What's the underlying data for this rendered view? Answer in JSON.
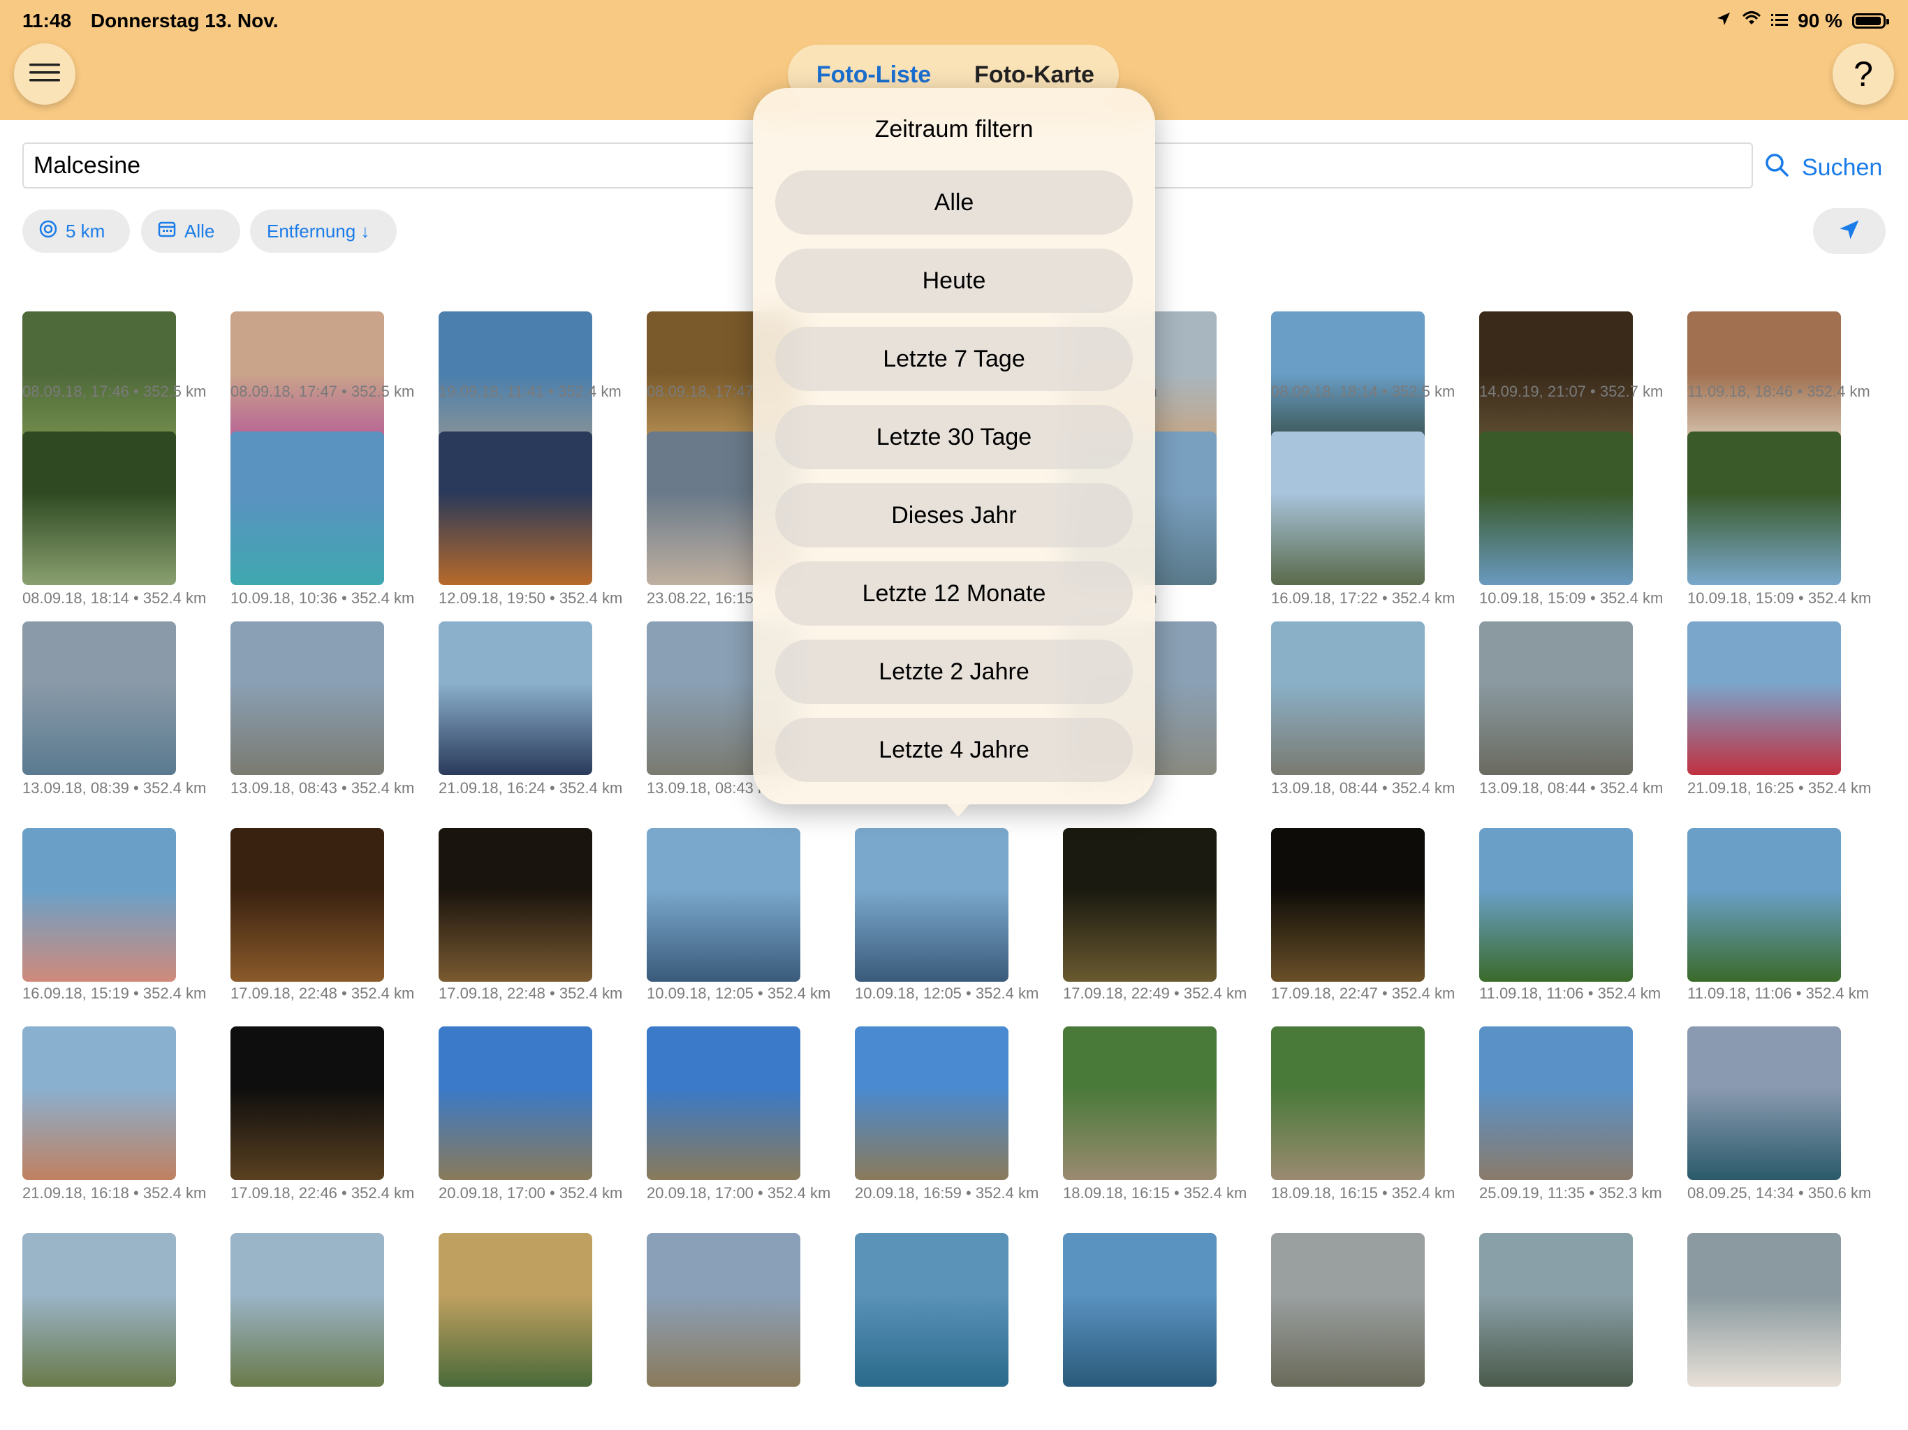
{
  "status_bar": {
    "time": "11:48",
    "date": "Donnerstag 13. Nov.",
    "battery": "90 %",
    "icons": [
      "location-arrow-icon",
      "wifi-icon",
      "list-icon",
      "battery-icon"
    ]
  },
  "header": {
    "menu_icon": "hamburger-icon",
    "help_label": "?",
    "tabs": [
      {
        "label": "Foto-Liste",
        "selected": true
      },
      {
        "label": "Foto-Karte",
        "selected": false
      }
    ]
  },
  "search": {
    "value": "Malcesine",
    "button_label": "Suchen",
    "icon": "search-icon"
  },
  "filters": {
    "distance": {
      "label": "5 km",
      "icon": "radius-icon"
    },
    "time": {
      "label": "Alle",
      "icon": "calendar-icon"
    },
    "sort": {
      "label": "Entfernung ↓"
    },
    "locate_icon": "location-arrow-icon"
  },
  "popover": {
    "title": "Zeitraum filtern",
    "options": [
      "Alle",
      "Heute",
      "Letzte 7 Tage",
      "Letzte 30 Tage",
      "Dieses Jahr",
      "Letzte 12 Monate",
      "Letzte 2 Jahre",
      "Letzte 4 Jahre"
    ]
  },
  "photos": [
    {
      "caption": "08.09.18, 17:46 • 352.5 km",
      "colors": [
        "#4f6a3a",
        "#7f9a52"
      ]
    },
    {
      "caption": "08.09.18, 17:47 • 352.5 km",
      "colors": [
        "#c9a48a",
        "#b04a9a"
      ]
    },
    {
      "caption": "19.09.18, 11:41 • 352.4 km",
      "colors": [
        "#4a7fae",
        "#9e9a8e"
      ]
    },
    {
      "caption": "08.09.18, 17:47",
      "colors": [
        "#7a5a2a",
        "#c8a060"
      ]
    },
    {
      "caption": "",
      "colors": [
        "#ffffff",
        "#ffffff"
      ]
    },
    {
      "caption": "33 • 352.5 km",
      "colors": [
        "#a8b6c0",
        "#d0a070"
      ]
    },
    {
      "caption": "08.09.18, 18:14 • 352.5 km",
      "colors": [
        "#6a9ec6",
        "#2a3a2a"
      ]
    },
    {
      "caption": "14.09.19, 21:07 • 352.7 km",
      "colors": [
        "#3a2a1a",
        "#6a5a3a"
      ]
    },
    {
      "caption": "11.09.18, 18:46 • 352.4 km",
      "colors": [
        "#a07050",
        "#e8e0d0"
      ]
    },
    {
      "caption": "08.09.18, 18:14 • 352.4 km",
      "colors": [
        "#2f4a22",
        "#8aa070"
      ]
    },
    {
      "caption": "10.09.18, 10:36 • 352.4 km",
      "colors": [
        "#5a92c0",
        "#3fa8b0"
      ]
    },
    {
      "caption": "12.09.18, 19:50 • 352.4 km",
      "colors": [
        "#2a3a5a",
        "#b86a2a"
      ]
    },
    {
      "caption": "23.08.22, 16:15",
      "colors": [
        "#6a7a8a",
        "#c0b0a0"
      ]
    },
    {
      "caption": "",
      "colors": [
        "#ffffff",
        "#ffffff"
      ]
    },
    {
      "caption": "22 • 352.4 km",
      "colors": [
        "#7aa0c0",
        "#5a7a8a"
      ]
    },
    {
      "caption": "16.09.18, 17:22 • 352.4 km",
      "colors": [
        "#a8c4dc",
        "#5a6a4a"
      ]
    },
    {
      "caption": "10.09.18, 15:09 • 352.4 km",
      "colors": [
        "#3a5a2a",
        "#6a9ac0"
      ]
    },
    {
      "caption": "10.09.18, 15:09 • 352.4 km",
      "colors": [
        "#3a5a2a",
        "#7aa8cc"
      ]
    },
    {
      "caption": "13.09.18, 08:39 • 352.4 km",
      "colors": [
        "#8a9aa8",
        "#5a7a90"
      ]
    },
    {
      "caption": "13.09.18, 08:43 • 352.4 km",
      "colors": [
        "#8aa0b4",
        "#7a7a70"
      ]
    },
    {
      "caption": "21.09.18, 16:24 • 352.4 km",
      "colors": [
        "#8ab0cc",
        "#2a3a5a"
      ]
    },
    {
      "caption": "13.09.18, 08:43 km",
      "colors": [
        "#8aa0b4",
        "#7a7a70"
      ]
    },
    {
      "caption": "",
      "colors": [
        "#ffffff",
        "#ffffff"
      ]
    },
    {
      "caption": "8:44 • 352.4",
      "colors": [
        "#8aa0b4",
        "#8a8a80"
      ]
    },
    {
      "caption": "13.09.18, 08:44 • 352.4 km",
      "colors": [
        "#8ab0c8",
        "#7a7a70"
      ]
    },
    {
      "caption": "13.09.18, 08:44 • 352.4 km",
      "colors": [
        "#8a9aa0",
        "#6a6a60"
      ]
    },
    {
      "caption": "21.09.18, 16:25 • 352.4 km",
      "colors": [
        "#7aa6cc",
        "#c03040"
      ]
    },
    {
      "caption": "16.09.18, 15:19 • 352.4 km",
      "colors": [
        "#6aa0c8",
        "#d08a7a"
      ]
    },
    {
      "caption": "17.09.18, 22:48 • 352.4 km",
      "colors": [
        "#3a2210",
        "#8a5a2a"
      ]
    },
    {
      "caption": "17.09.18, 22:48 • 352.4 km",
      "colors": [
        "#1a140e",
        "#7a5a30"
      ]
    },
    {
      "caption": "10.09.18, 12:05 • 352.4 km",
      "colors": [
        "#7aa8cc",
        "#3a5a7a"
      ]
    },
    {
      "caption": "10.09.18, 12:05 • 352.4 km",
      "colors": [
        "#7aa8cc",
        "#3a5a7a"
      ]
    },
    {
      "caption": "17.09.18, 22:49 • 352.4 km",
      "colors": [
        "#1a1a10",
        "#6a5a30"
      ]
    },
    {
      "caption": "17.09.18, 22:47 • 352.4 km",
      "colors": [
        "#0e0c08",
        "#6a5028"
      ]
    },
    {
      "caption": "11.09.18, 11:06 • 352.4 km",
      "colors": [
        "#6aa0c8",
        "#3a6a2a"
      ]
    },
    {
      "caption": "11.09.18, 11:06 • 352.4 km",
      "colors": [
        "#6aa0c8",
        "#3a6a2a"
      ]
    },
    {
      "caption": "21.09.18, 16:18 • 352.4 km",
      "colors": [
        "#8ab0d0",
        "#c08060"
      ]
    },
    {
      "caption": "17.09.18, 22:46 • 352.4 km",
      "colors": [
        "#0e0e0e",
        "#5a4020"
      ]
    },
    {
      "caption": "20.09.18, 17:00 • 352.4 km",
      "colors": [
        "#3a7ac8",
        "#8a7a5a"
      ]
    },
    {
      "caption": "20.09.18, 17:00 • 352.4 km",
      "colors": [
        "#3a7ac8",
        "#8a7a5a"
      ]
    },
    {
      "caption": "20.09.18, 16:59 • 352.4 km",
      "colors": [
        "#4a8ad0",
        "#8a7a5a"
      ]
    },
    {
      "caption": "18.09.18, 16:15 • 352.4 km",
      "colors": [
        "#4a7a3a",
        "#9a8a70"
      ]
    },
    {
      "caption": "18.09.18, 16:15 • 352.4 km",
      "colors": [
        "#4a7a3a",
        "#9a8a70"
      ]
    },
    {
      "caption": "25.09.19, 11:35 • 352.3 km",
      "colors": [
        "#5a92c8",
        "#8a7a6a"
      ]
    },
    {
      "caption": "08.09.25, 14:34 • 350.6 km",
      "colors": [
        "#8a9ab0",
        "#2a5a6a"
      ]
    },
    {
      "caption": "",
      "colors": [
        "#9ab4c8",
        "#6a7a4a"
      ]
    },
    {
      "caption": "",
      "colors": [
        "#9ab4c8",
        "#6a7a4a"
      ]
    },
    {
      "caption": "",
      "colors": [
        "#c0a060",
        "#4a6a3a"
      ]
    },
    {
      "caption": "",
      "colors": [
        "#8aa0b8",
        "#8a7a5a"
      ]
    },
    {
      "caption": "",
      "colors": [
        "#5a92b8",
        "#2a6a8a"
      ]
    },
    {
      "caption": "",
      "colors": [
        "#5a92c0",
        "#2a5a7a"
      ]
    },
    {
      "caption": "",
      "colors": [
        "#9aa0a0",
        "#6a6a5a"
      ]
    },
    {
      "caption": "",
      "colors": [
        "#8aa0a8",
        "#4a5a4a"
      ]
    },
    {
      "caption": "",
      "colors": [
        "#8a9aa0",
        "#e8e0d8"
      ]
    }
  ]
}
